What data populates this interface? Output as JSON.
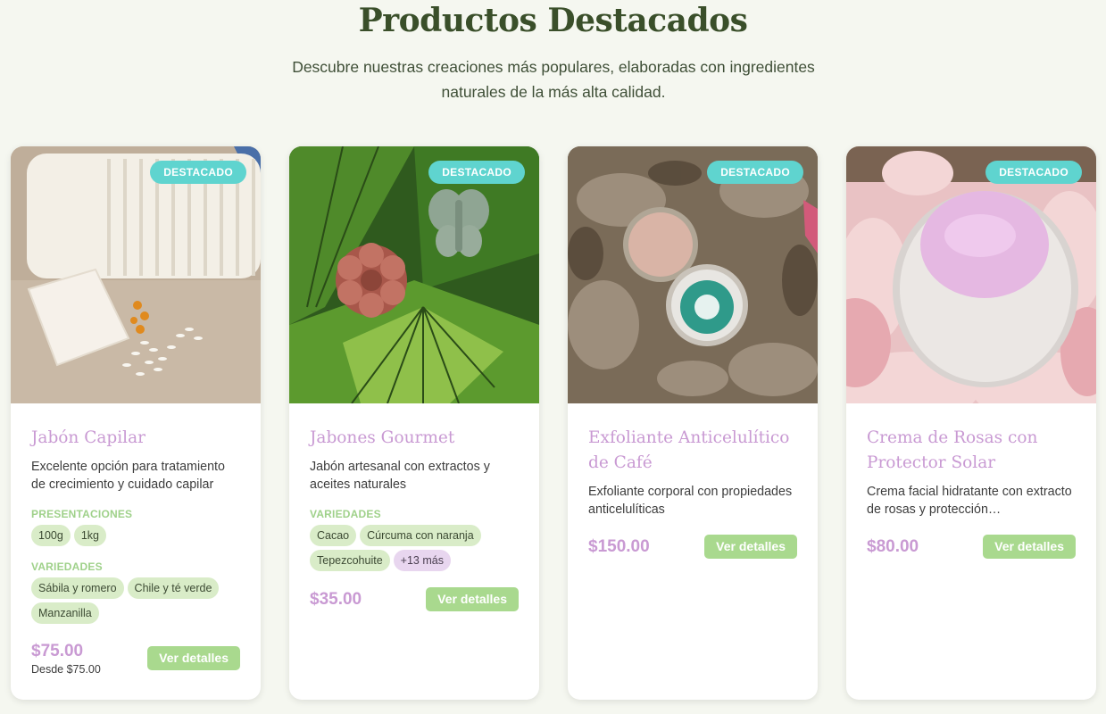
{
  "section": {
    "title": "Productos Destacados",
    "subtitle": "Descubre nuestras creaciones más populares, elaboradas con ingredientes naturales de la más alta calidad."
  },
  "colors": {
    "accent_pink": "#c99ad3",
    "accent_green": "#a9d98e",
    "badge_teal": "#5fd4cf",
    "title_green": "#3a4f2a"
  },
  "products": [
    {
      "badge": "DESTACADO",
      "title": "Jabón Capilar",
      "description": "Excelente opción para tratamiento de crecimiento y cuidado capilar",
      "groups": [
        {
          "label": "PRESENTACIONES",
          "chips": [
            "100g",
            "1kg"
          ]
        },
        {
          "label": "VARIEDADES",
          "chips": [
            "Sábila y romero",
            "Chile y té verde",
            "Manzanilla"
          ]
        }
      ],
      "price": "$75.00",
      "price_from": "Desde $75.00",
      "button": "Ver detalles",
      "image": "soap-bar-rice-image"
    },
    {
      "badge": "DESTACADO",
      "title": "Jabones Gourmet",
      "description": "Jabón artesanal con extractos y aceites naturales",
      "groups": [
        {
          "label": "VARIEDADES",
          "chips": [
            "Cacao",
            "Cúrcuma con naranja",
            "Tepezcohuite"
          ],
          "more": "+13 más"
        }
      ],
      "price": "$35.00",
      "button": "Ver detalles",
      "image": "shaped-soaps-leaves-image"
    },
    {
      "badge": "DESTACADO",
      "title": "Exfoliante Anticelulítico de Café",
      "description": "Exfoliante corporal con propiedades anticelulíticas",
      "price": "$150.00",
      "button": "Ver detalles",
      "image": "scrub-tin-rock-image"
    },
    {
      "badge": "DESTACADO",
      "title": "Crema de Rosas con Protector Solar",
      "description": "Crema facial hidratante con extracto de rosas y protección…",
      "price": "$80.00",
      "button": "Ver detalles",
      "image": "rose-cream-jar-image"
    }
  ]
}
